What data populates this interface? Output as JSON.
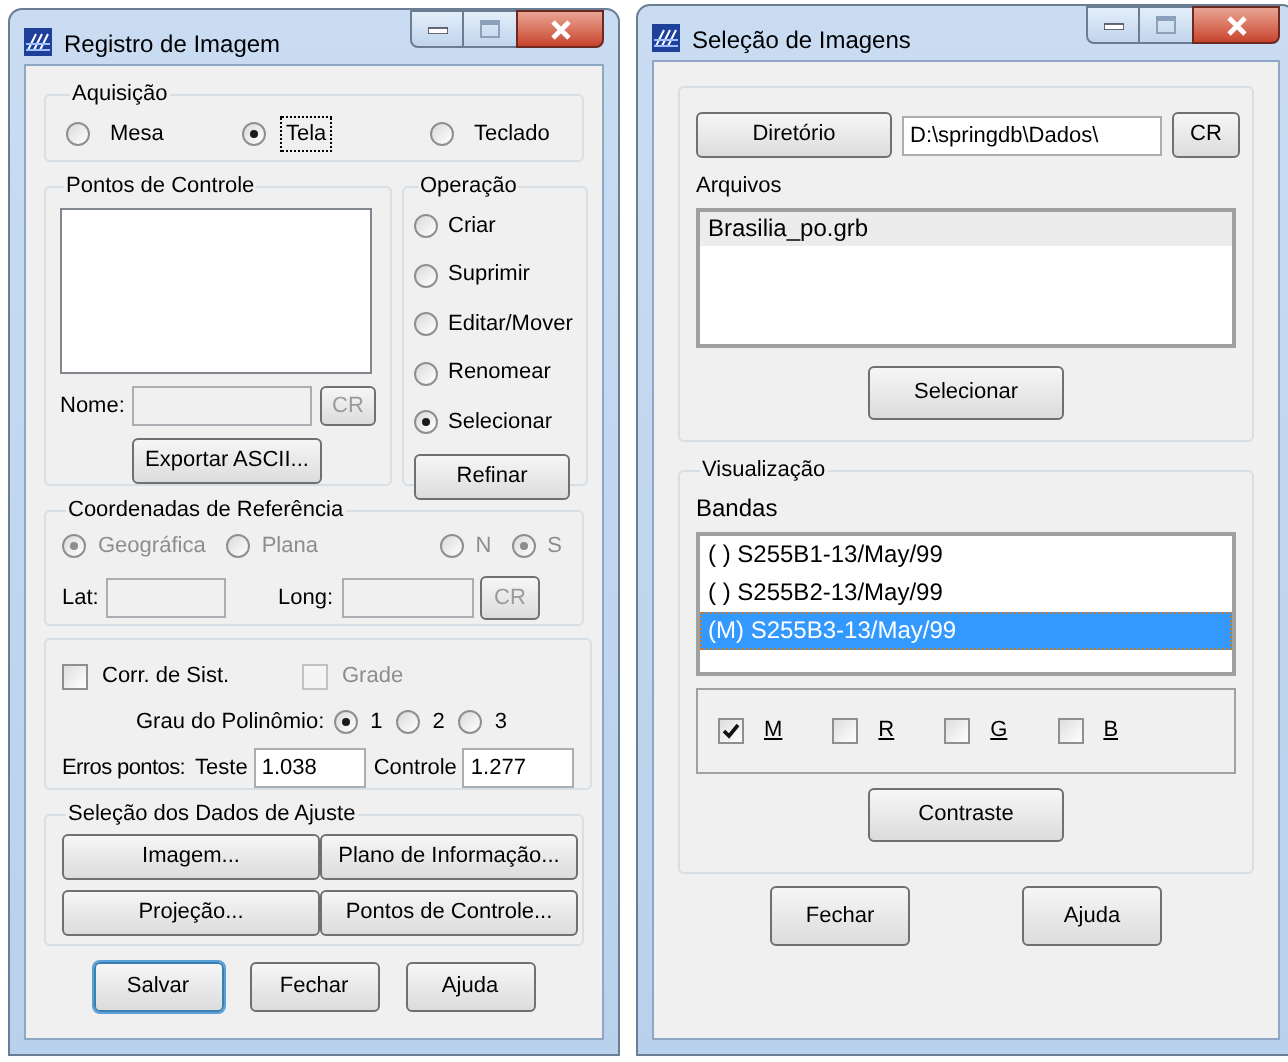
{
  "left_window": {
    "title": "Registro de Imagem",
    "aquisicao": {
      "label": "Aquisição",
      "options": [
        {
          "label": "Mesa",
          "selected": false,
          "focused": false
        },
        {
          "label": "Tela",
          "selected": true,
          "focused": true
        },
        {
          "label": "Teclado",
          "selected": false,
          "focused": false
        }
      ]
    },
    "pontos_de_controle": {
      "label": "Pontos de Controle",
      "nome_label": "Nome:",
      "nome_field": {
        "disabled": true
      },
      "cr_button": {
        "label": "CR",
        "disabled": true
      },
      "export_button": "Exportar ASCII..."
    },
    "operacao": {
      "label": "Operação",
      "options": [
        {
          "label": "Criar",
          "selected": false
        },
        {
          "label": "Suprimir",
          "selected": false
        },
        {
          "label": "Editar/Mover",
          "selected": false
        },
        {
          "label": "Renomear",
          "selected": false
        },
        {
          "label": "Selecionar",
          "selected": true
        }
      ],
      "refinar_button": "Refinar"
    },
    "coordenadas": {
      "label": "Coordenadas de Referência",
      "system_options": [
        {
          "label": "Geográfica",
          "selected": true,
          "disabled": true
        },
        {
          "label": "Plana",
          "selected": false,
          "disabled": true
        }
      ],
      "hemisphere_options": [
        {
          "label": "N",
          "selected": false,
          "disabled": true
        },
        {
          "label": "S",
          "selected": true,
          "disabled": true
        }
      ],
      "lat_label": "Lat:",
      "lat_field": {
        "disabled": true
      },
      "long_label": "Long:",
      "long_field": {
        "disabled": true
      },
      "cr_button": {
        "label": "CR",
        "disabled": true
      }
    },
    "correcao": {
      "checkboxes": [
        {
          "label": "Corr. de Sist.",
          "checked": false,
          "disabled": false
        },
        {
          "label": "Grade",
          "checked": false,
          "disabled": true
        }
      ],
      "grau_label": "Grau do Polinômio:",
      "grau_options": [
        {
          "label": "1",
          "selected": true
        },
        {
          "label": "2",
          "selected": false
        },
        {
          "label": "3",
          "selected": false
        }
      ],
      "erros_label": "Erros pontos:",
      "teste_label": "Teste",
      "teste_value": "1.038",
      "controle_label": "Controle",
      "controle_value": "1.277"
    },
    "selecao": {
      "label": "Seleção dos Dados de Ajuste",
      "buttons": [
        "Imagem...",
        "Plano de Informação...",
        "Projeção...",
        "Pontos de Controle..."
      ]
    },
    "footer_buttons": [
      "Salvar",
      "Fechar",
      "Ajuda"
    ]
  },
  "right_window": {
    "title": "Seleção de Imagens",
    "directory_button": "Diretório",
    "directory_value": "D:\\springdb\\Dados\\",
    "cr_button": "CR",
    "arquivos_label": "Arquivos",
    "files": [
      {
        "label": "Brasilia_po.grb",
        "selected": true
      }
    ],
    "selecionar_button": "Selecionar",
    "visualizacao": {
      "label": "Visualização",
      "bandas_label": "Bandas",
      "bands": [
        {
          "label": "( ) S255B1-13/May/99",
          "selected": false
        },
        {
          "label": "( ) S255B2-13/May/99",
          "selected": false
        },
        {
          "label": "(M) S255B3-13/May/99",
          "selected": true
        }
      ],
      "channels": [
        {
          "label": "M",
          "checked": true
        },
        {
          "label": "R",
          "checked": false
        },
        {
          "label": "G",
          "checked": false
        },
        {
          "label": "B",
          "checked": false
        }
      ],
      "contraste_button": "Contraste"
    },
    "footer_buttons": [
      "Fechar",
      "Ajuda"
    ]
  }
}
